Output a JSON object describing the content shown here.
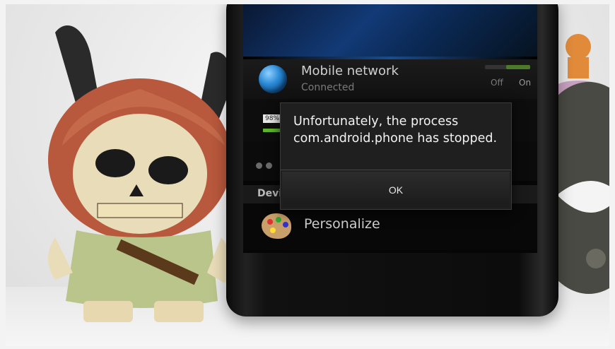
{
  "dialog": {
    "message": "Unfortunately, the process com.android.phone has stopped.",
    "ok_label": "OK"
  },
  "settings": {
    "mobile_network": {
      "title": "Mobile network",
      "status": "Connected",
      "toggle_off": "Off",
      "toggle_on": "On"
    },
    "battery": {
      "percent_label": "98%",
      "level": 0.98
    },
    "device_header": "Devi",
    "personalize_label": "Personalize"
  },
  "colors": {
    "dialog_bg": "#1f1f1f",
    "battery_green": "#5fb52e",
    "wallpaper_blue": "#123a76"
  }
}
